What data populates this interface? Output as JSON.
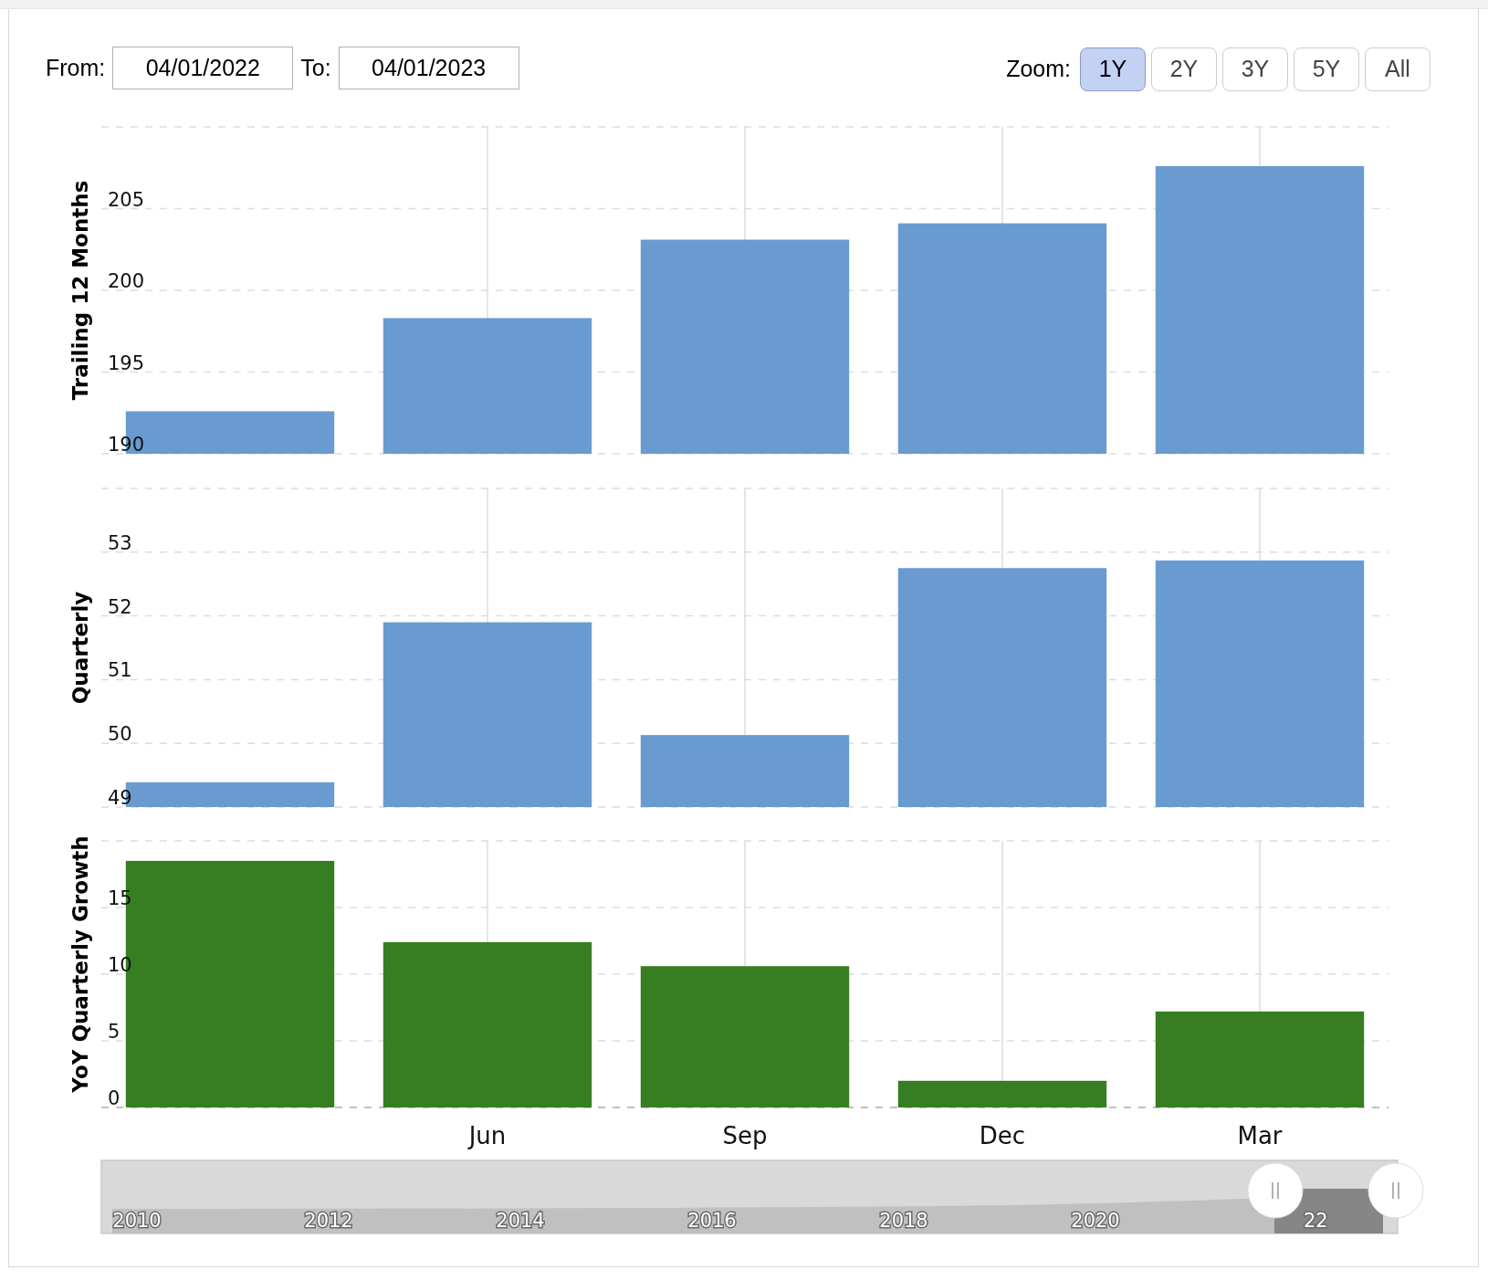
{
  "range": {
    "from_label": "From:",
    "from_value": "04/01/2022",
    "to_label": "To:",
    "to_value": "04/01/2023"
  },
  "zoom": {
    "label": "Zoom:",
    "buttons": [
      {
        "label": "1Y",
        "selected": true
      },
      {
        "label": "2Y",
        "selected": false
      },
      {
        "label": "3Y",
        "selected": false
      },
      {
        "label": "5Y",
        "selected": false
      },
      {
        "label": "All",
        "selected": false
      }
    ]
  },
  "charts": [
    {
      "chart_data": {
        "type": "bar",
        "grid": true,
        "ylabel": "Trailing 12 Months",
        "ylim": [
          190,
          210
        ],
        "yticks": [
          190,
          195,
          200,
          205
        ],
        "series": [
          {
            "color": "#699bd0",
            "values": [
              192.6,
              198.3,
              203.1,
              204.1,
              207.6
            ]
          }
        ]
      }
    },
    {
      "chart_data": {
        "type": "bar",
        "grid": true,
        "ylabel": "Quarterly",
        "ylim": [
          49,
          54
        ],
        "yticks": [
          49,
          50,
          51,
          52,
          53
        ],
        "series": [
          {
            "color": "#699bd0",
            "values": [
              49.39,
              51.9,
              50.13,
              52.75,
              52.87
            ]
          }
        ]
      }
    },
    {
      "chart_data": {
        "type": "bar",
        "grid": true,
        "ylabel": "YoY Quarterly Growth",
        "categories": [
          null,
          "Jun",
          "Sep",
          "Dec",
          "Mar"
        ],
        "ylim": [
          0,
          20
        ],
        "yticks": [
          0,
          5,
          10,
          15
        ],
        "series": [
          {
            "color": "#377e22",
            "values": [
              18.5,
              12.4,
              10.6,
              2.0,
              7.2
            ]
          }
        ]
      }
    }
  ],
  "navigator": {
    "labels": [
      "2010",
      "2012",
      "2014",
      "2016",
      "2018",
      "2020",
      "22"
    ]
  }
}
